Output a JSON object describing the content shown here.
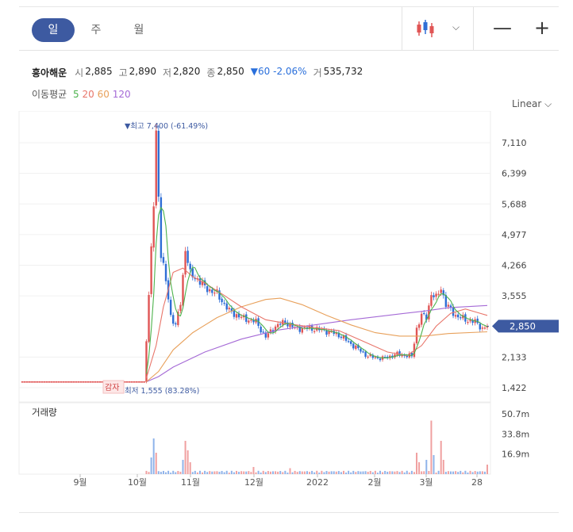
{
  "tabs": {
    "day": "일",
    "week": "주",
    "month": "월"
  },
  "stock": {
    "name": "흥아해운",
    "open_label": "시",
    "open": "2,885",
    "high_label": "고",
    "high": "2,890",
    "low_label": "저",
    "low": "2,820",
    "close_label": "종",
    "close": "2,850",
    "change": "▼60 -2.06%",
    "volume_label": "거",
    "volume": "535,732"
  },
  "ma": {
    "label": "이동평균",
    "p5": "5",
    "p20": "20",
    "p60": "60",
    "p120": "120"
  },
  "scale": "Linear",
  "colors": {
    "up": "#e05555",
    "down": "#2f6ed6",
    "ma5": "#4db34d",
    "ma20": "#e8756a",
    "ma60": "#e8a05a",
    "ma120": "#a56ad6",
    "price_tag": "#3d5aa1"
  },
  "chart_data": {
    "type": "candlestick",
    "y_ticks": [
      "7,110",
      "6,399",
      "5,688",
      "4,977",
      "4,266",
      "3,555",
      "2,133",
      "1,422"
    ],
    "y_tick_values": [
      7110,
      6399,
      5688,
      4977,
      4266,
      3555,
      2133,
      1422
    ],
    "ylim": [
      1100,
      7800
    ],
    "x_ticks": [
      "9월",
      "10월",
      "11월",
      "12월",
      "2022",
      "2월",
      "3월",
      "28"
    ],
    "current_price": "2,850",
    "current_value": 2850,
    "high_annotation": "▼최고 7,400 (-61.49%)",
    "low_annotation": "최저 1,555 (83.28%)",
    "event_label": "감자",
    "volume_label": "거래량",
    "volume_ticks": [
      "50.7m",
      "33.8m",
      "16.9m"
    ],
    "volume_tick_values": [
      50.7,
      33.8,
      16.9
    ],
    "volume_max": 60,
    "anchors": [
      {
        "i": 0,
        "p": 1555
      },
      {
        "i": 50,
        "p": 1555
      },
      {
        "i": 51,
        "p": 2500
      },
      {
        "i": 53,
        "p": 4600
      },
      {
        "i": 54,
        "p": 5700
      },
      {
        "i": 55,
        "p": 7350
      },
      {
        "i": 57,
        "p": 4500
      },
      {
        "i": 59,
        "p": 3900
      },
      {
        "i": 61,
        "p": 3100
      },
      {
        "i": 63,
        "p": 2850
      },
      {
        "i": 65,
        "p": 3400
      },
      {
        "i": 67,
        "p": 4650
      },
      {
        "i": 69,
        "p": 4050
      },
      {
        "i": 72,
        "p": 3950
      },
      {
        "i": 75,
        "p": 3750
      },
      {
        "i": 80,
        "p": 3600
      },
      {
        "i": 85,
        "p": 3200
      },
      {
        "i": 90,
        "p": 3050
      },
      {
        "i": 96,
        "p": 2950
      },
      {
        "i": 100,
        "p": 2600
      },
      {
        "i": 104,
        "p": 2850
      },
      {
        "i": 108,
        "p": 2950
      },
      {
        "i": 112,
        "p": 2800
      },
      {
        "i": 118,
        "p": 2800
      },
      {
        "i": 124,
        "p": 2750
      },
      {
        "i": 130,
        "p": 2650
      },
      {
        "i": 136,
        "p": 2400
      },
      {
        "i": 142,
        "p": 2150
      },
      {
        "i": 148,
        "p": 2100
      },
      {
        "i": 154,
        "p": 2200
      },
      {
        "i": 160,
        "p": 2150
      },
      {
        "i": 162,
        "p": 2800
      },
      {
        "i": 164,
        "p": 3100
      },
      {
        "i": 166,
        "p": 3050
      },
      {
        "i": 168,
        "p": 3600
      },
      {
        "i": 170,
        "p": 3500
      },
      {
        "i": 172,
        "p": 3750
      },
      {
        "i": 174,
        "p": 3350
      },
      {
        "i": 178,
        "p": 3100
      },
      {
        "i": 182,
        "p": 3000
      },
      {
        "i": 186,
        "p": 2950
      },
      {
        "i": 189,
        "p": 2800
      },
      {
        "i": 191,
        "p": 2850
      }
    ],
    "ma20_points": [
      {
        "i": 51,
        "p": 1650
      },
      {
        "i": 55,
        "p": 2400
      },
      {
        "i": 58,
        "p": 3300
      },
      {
        "i": 62,
        "p": 4100
      },
      {
        "i": 66,
        "p": 4200
      },
      {
        "i": 70,
        "p": 4000
      },
      {
        "i": 75,
        "p": 3850
      },
      {
        "i": 82,
        "p": 3600
      },
      {
        "i": 90,
        "p": 3300
      },
      {
        "i": 100,
        "p": 3000
      },
      {
        "i": 110,
        "p": 2900
      },
      {
        "i": 120,
        "p": 2820
      },
      {
        "i": 130,
        "p": 2750
      },
      {
        "i": 140,
        "p": 2500
      },
      {
        "i": 150,
        "p": 2250
      },
      {
        "i": 158,
        "p": 2170
      },
      {
        "i": 164,
        "p": 2400
      },
      {
        "i": 170,
        "p": 2850
      },
      {
        "i": 176,
        "p": 3150
      },
      {
        "i": 182,
        "p": 3250
      },
      {
        "i": 188,
        "p": 3150
      },
      {
        "i": 191,
        "p": 3100
      }
    ],
    "ma60_points": [
      {
        "i": 51,
        "p": 1560
      },
      {
        "i": 56,
        "p": 1800
      },
      {
        "i": 62,
        "p": 2300
      },
      {
        "i": 70,
        "p": 2700
      },
      {
        "i": 80,
        "p": 3050
      },
      {
        "i": 90,
        "p": 3300
      },
      {
        "i": 100,
        "p": 3470
      },
      {
        "i": 106,
        "p": 3500
      },
      {
        "i": 115,
        "p": 3350
      },
      {
        "i": 125,
        "p": 3100
      },
      {
        "i": 135,
        "p": 2880
      },
      {
        "i": 145,
        "p": 2700
      },
      {
        "i": 155,
        "p": 2620
      },
      {
        "i": 165,
        "p": 2620
      },
      {
        "i": 175,
        "p": 2680
      },
      {
        "i": 191,
        "p": 2720
      }
    ],
    "ma120_points": [
      {
        "i": 51,
        "p": 1560
      },
      {
        "i": 56,
        "p": 1680
      },
      {
        "i": 62,
        "p": 1900
      },
      {
        "i": 75,
        "p": 2250
      },
      {
        "i": 90,
        "p": 2550
      },
      {
        "i": 105,
        "p": 2760
      },
      {
        "i": 120,
        "p": 2880
      },
      {
        "i": 135,
        "p": 3000
      },
      {
        "i": 150,
        "p": 3100
      },
      {
        "i": 165,
        "p": 3200
      },
      {
        "i": 175,
        "p": 3280
      },
      {
        "i": 191,
        "p": 3330
      }
    ],
    "volume_spikes": [
      {
        "i": 50,
        "v": 20,
        "up": true
      },
      {
        "i": 53,
        "v": 14,
        "up": false
      },
      {
        "i": 54,
        "v": 30,
        "up": false
      },
      {
        "i": 55,
        "v": 18,
        "up": true
      },
      {
        "i": 66,
        "v": 12,
        "up": false
      },
      {
        "i": 67,
        "v": 28,
        "up": true
      },
      {
        "i": 68,
        "v": 20,
        "up": true
      },
      {
        "i": 69,
        "v": 10,
        "up": true
      },
      {
        "i": 95,
        "v": 6,
        "up": true
      },
      {
        "i": 110,
        "v": 5,
        "up": true
      },
      {
        "i": 162,
        "v": 18,
        "up": true
      },
      {
        "i": 163,
        "v": 10,
        "up": true
      },
      {
        "i": 166,
        "v": 12,
        "up": false
      },
      {
        "i": 168,
        "v": 45,
        "up": true
      },
      {
        "i": 169,
        "v": 16,
        "up": false
      },
      {
        "i": 172,
        "v": 28,
        "up": true
      },
      {
        "i": 173,
        "v": 12,
        "up": true
      },
      {
        "i": 191,
        "v": 8,
        "up": true
      }
    ]
  }
}
